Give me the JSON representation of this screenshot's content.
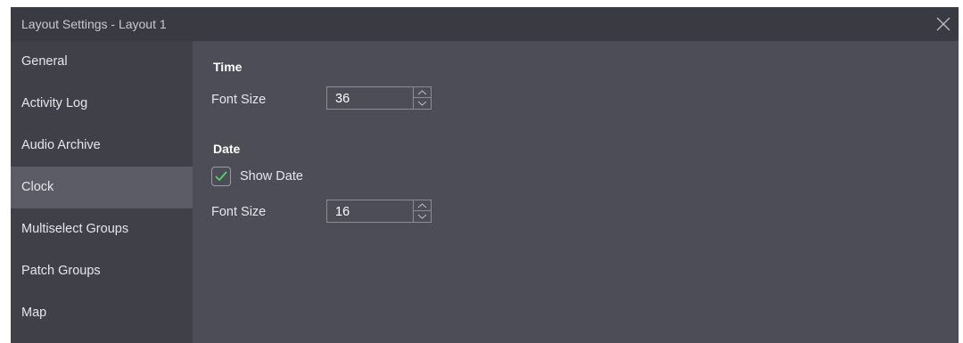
{
  "window": {
    "title": "Layout Settings - Layout 1",
    "close_icon": "close-icon"
  },
  "sidebar": {
    "selected": "Clock",
    "items": [
      {
        "label": "General"
      },
      {
        "label": "Activity Log"
      },
      {
        "label": "Audio Archive"
      },
      {
        "label": "Clock"
      },
      {
        "label": "Multiselect Groups"
      },
      {
        "label": "Patch Groups"
      },
      {
        "label": "Map"
      }
    ]
  },
  "main": {
    "time": {
      "heading": "Time",
      "font_size_label": "Font Size",
      "font_size_value": "36"
    },
    "date": {
      "heading": "Date",
      "show_date_label": "Show Date",
      "show_date_checked": true,
      "font_size_label": "Font Size",
      "font_size_value": "16"
    }
  },
  "colors": {
    "titlebar": "#3a3a42",
    "sidebar": "#404048",
    "sidebar_selected": "#5c5c66",
    "content": "#4d4d57",
    "check_accent": "#4cd964"
  }
}
